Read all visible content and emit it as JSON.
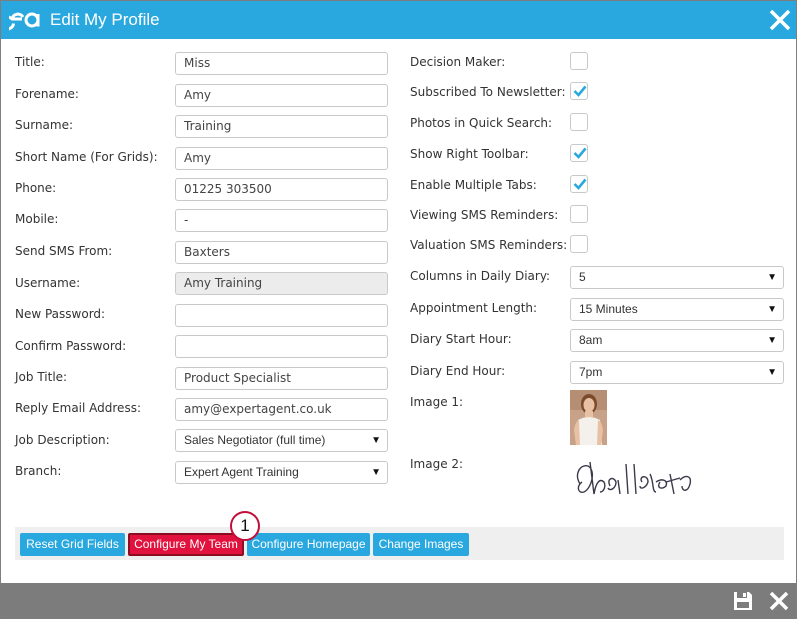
{
  "window": {
    "title": "Edit My Profile",
    "logo_icon": "ea-logo-icon",
    "close_icon": "close-icon"
  },
  "left_fields": [
    {
      "label": "Title:",
      "value": "Miss",
      "type": "text"
    },
    {
      "label": "Forename:",
      "value": "Amy",
      "type": "text"
    },
    {
      "label": "Surname:",
      "value": "Training",
      "type": "text"
    },
    {
      "label": "Short Name (For Grids):",
      "value": "Amy",
      "type": "text"
    },
    {
      "label": "Phone:",
      "value": "01225 303500",
      "type": "text"
    },
    {
      "label": "Mobile:",
      "value": "-",
      "type": "text"
    },
    {
      "label": "Send SMS From:",
      "value": "Baxters",
      "type": "text"
    },
    {
      "label": "Username:",
      "value": "Amy Training",
      "type": "readonly"
    },
    {
      "label": "New Password:",
      "value": "",
      "type": "password"
    },
    {
      "label": "Confirm Password:",
      "value": "",
      "type": "password"
    },
    {
      "label": "Job Title:",
      "value": "Product Specialist",
      "type": "text"
    },
    {
      "label": "Reply Email Address:",
      "value": "amy@expertagent.co.uk",
      "type": "text"
    },
    {
      "label": "Job Description:",
      "value": "Sales Negotiator (full time)",
      "type": "select"
    },
    {
      "label": "Branch:",
      "value": "Expert Agent Training",
      "type": "select"
    }
  ],
  "right_checkboxes": [
    {
      "label": "Decision Maker:",
      "checked": false
    },
    {
      "label": "Subscribed To Newsletter:",
      "checked": true
    },
    {
      "label": "Photos in Quick Search:",
      "checked": false
    },
    {
      "label": "Show Right Toolbar:",
      "checked": true
    },
    {
      "label": "Enable Multiple Tabs:",
      "checked": true
    },
    {
      "label": "Viewing SMS Reminders:",
      "checked": false
    },
    {
      "label": "Valuation SMS Reminders:",
      "checked": false
    }
  ],
  "right_selects": [
    {
      "label": "Columns in Daily Diary:",
      "value": "5"
    },
    {
      "label": "Appointment Length:",
      "value": "15 Minutes"
    },
    {
      "label": "Diary Start Hour:",
      "value": "8am"
    },
    {
      "label": "Diary End Hour:",
      "value": "7pm"
    }
  ],
  "images": {
    "image1_label": "Image 1:",
    "image2_label": "Image 2:"
  },
  "buttons": {
    "reset_grid": "Reset Grid Fields",
    "configure_team": "Configure My Team",
    "configure_homepage": "Configure Homepage",
    "change_images": "Change Images"
  },
  "callout": {
    "number": "1"
  },
  "colors": {
    "accent": "#29a8e0",
    "highlight": "#e1123d",
    "footer": "#7c7c7c",
    "check": "#29a8e0"
  },
  "footer": {
    "save_icon": "save-icon",
    "close_icon": "close-icon"
  }
}
